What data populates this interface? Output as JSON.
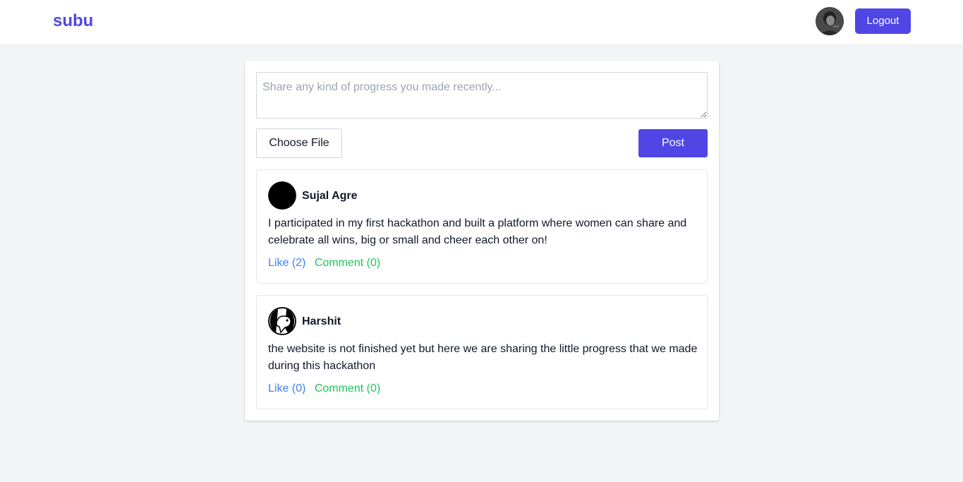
{
  "header": {
    "brand": "subu",
    "avatar_icon": "user-avatar-icon",
    "logout_label": "Logout"
  },
  "composer": {
    "placeholder": "Share any kind of progress you made recently...",
    "value": "",
    "file_label": "Choose File",
    "post_label": "Post"
  },
  "posts": [
    {
      "author": "Sujal Agre",
      "avatar_icon": "black-circle-avatar-icon",
      "body": "I participated in my first hackathon and built a platform where women can share and celebrate all wins, big or small and cheer each other on!",
      "like_label": "Like (2)",
      "comment_label": "Comment (0)"
    },
    {
      "author": "Harshit",
      "avatar_icon": "creature-avatar-icon",
      "body": "the website is not finished yet but here we are sharing the little progress that we made during this hackathon",
      "like_label": "Like (0)",
      "comment_label": "Comment (0)"
    }
  ],
  "colors": {
    "accent": "#4f46e5",
    "background": "#f3f4f6",
    "like": "#3b82f6",
    "comment": "#22c55e"
  }
}
